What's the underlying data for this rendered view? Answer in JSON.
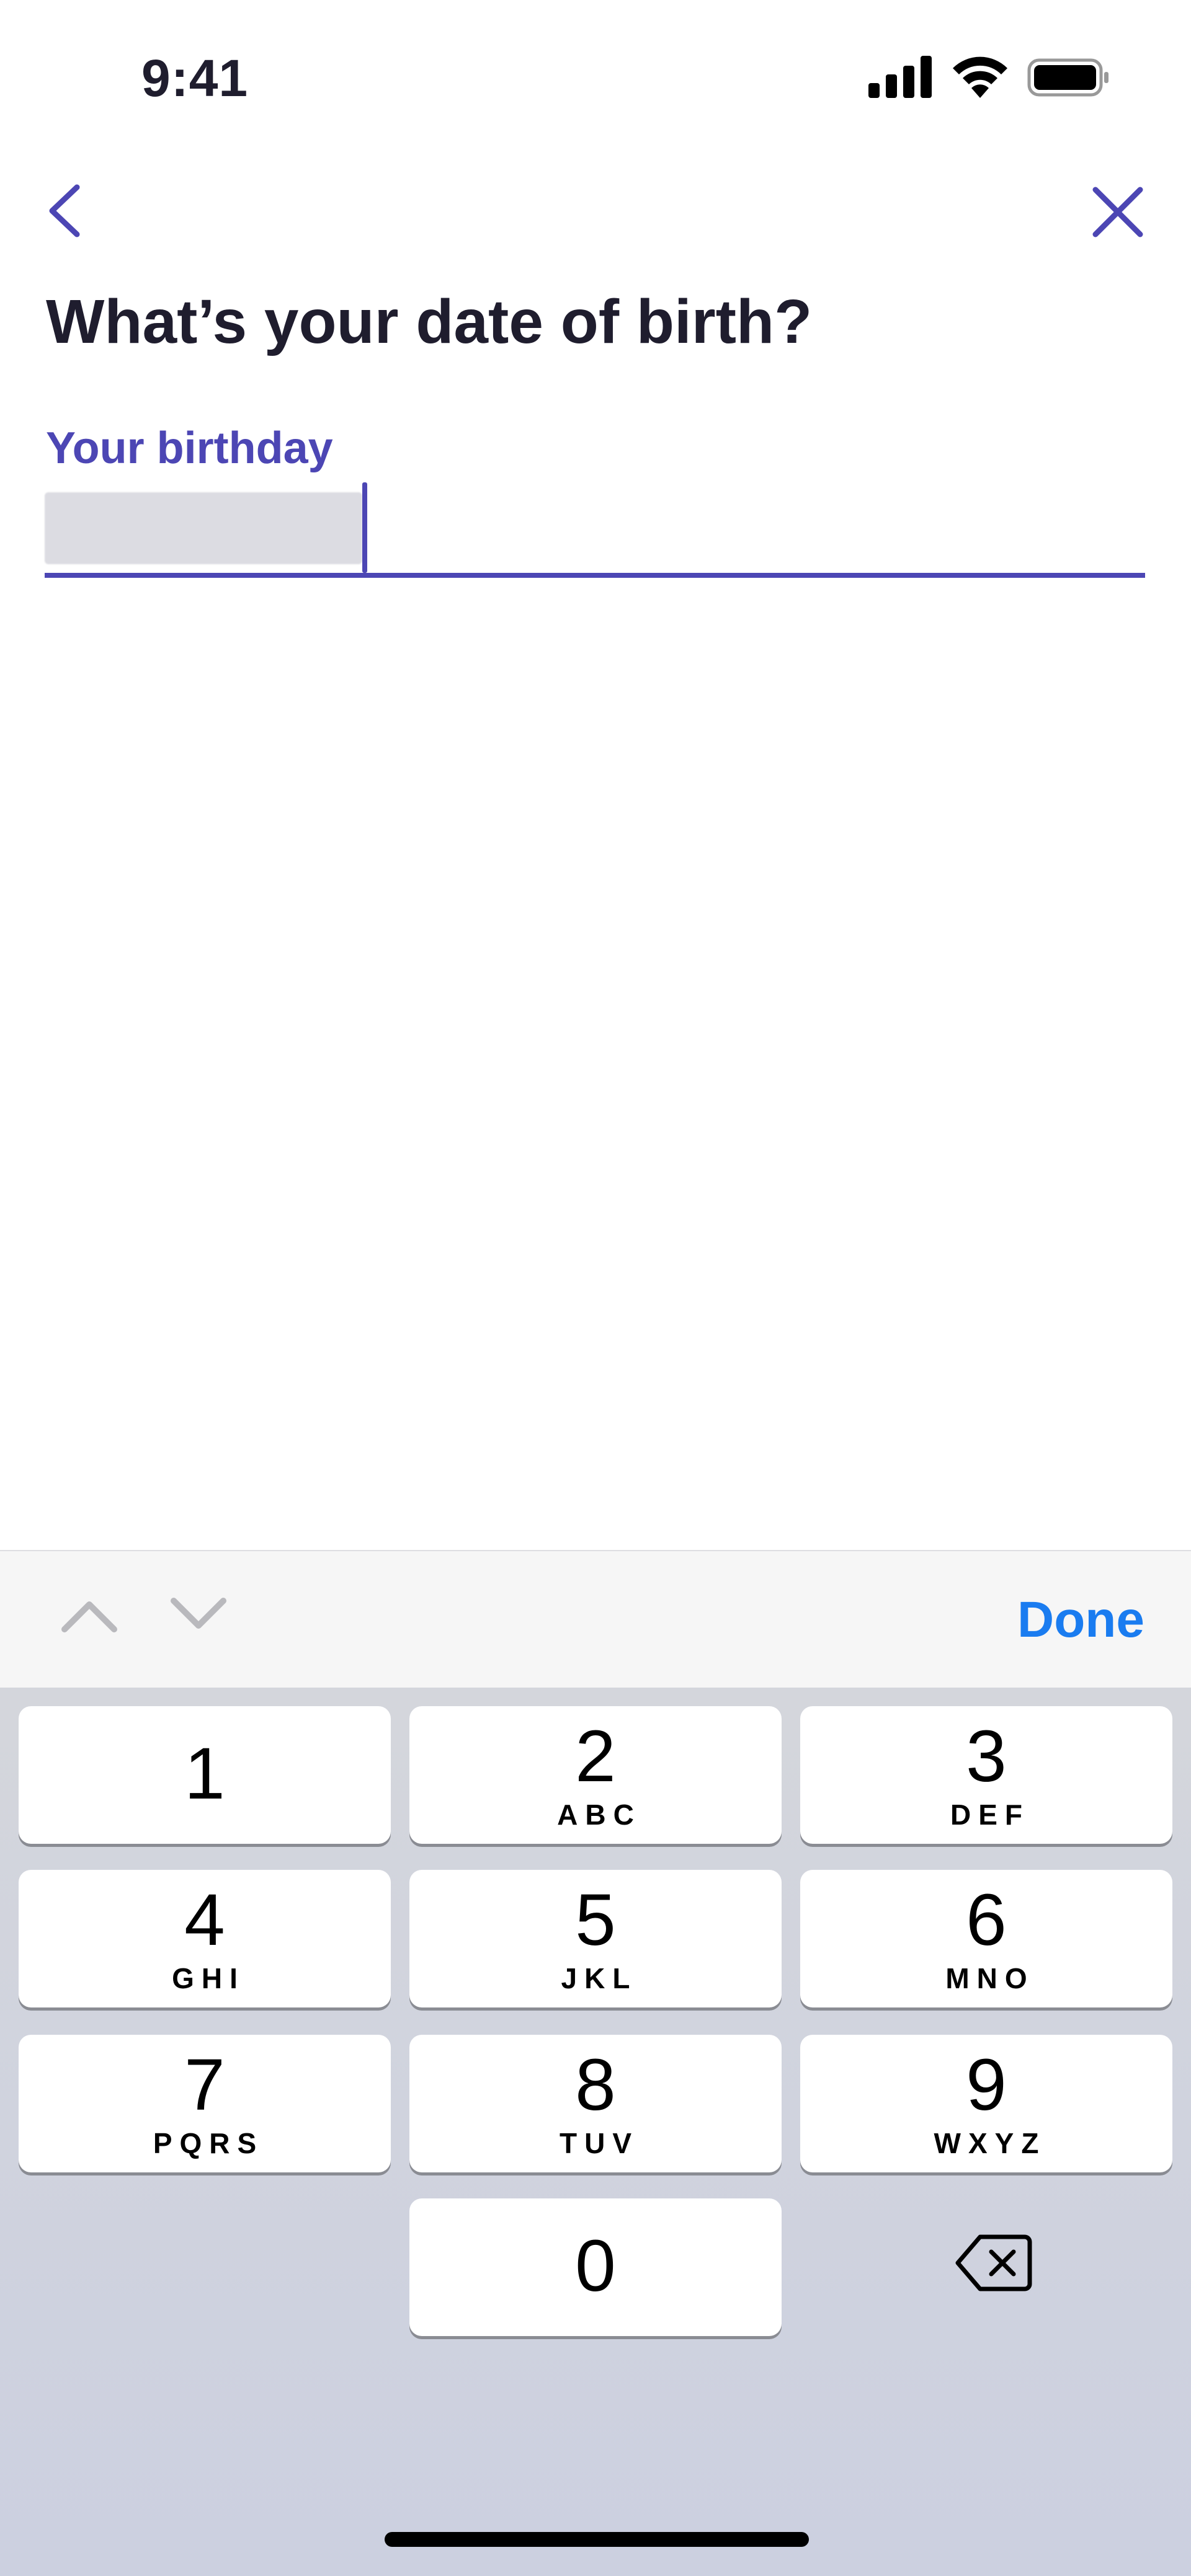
{
  "status_bar": {
    "time": "9:41"
  },
  "page": {
    "title": "What’s your date of birth?",
    "field_label": "Your birthday",
    "field_value": ""
  },
  "accessory": {
    "done_label": "Done"
  },
  "keypad": {
    "keys": [
      {
        "num": "1",
        "letters": ""
      },
      {
        "num": "2",
        "letters": "ABC"
      },
      {
        "num": "3",
        "letters": "DEF"
      },
      {
        "num": "4",
        "letters": "GHI"
      },
      {
        "num": "5",
        "letters": "JKL"
      },
      {
        "num": "6",
        "letters": "MNO"
      },
      {
        "num": "7",
        "letters": "PQRS"
      },
      {
        "num": "8",
        "letters": "TUV"
      },
      {
        "num": "9",
        "letters": "WXYZ"
      },
      {
        "num": "0",
        "letters": ""
      }
    ]
  },
  "colors": {
    "accent": "#4c46b4",
    "done": "#1a7cf0",
    "text": "#1f1d2e"
  },
  "icons": [
    "back-icon",
    "close-icon",
    "cellular-signal-icon",
    "wifi-icon",
    "battery-icon",
    "chevron-up-icon",
    "chevron-down-icon",
    "delete-icon"
  ]
}
